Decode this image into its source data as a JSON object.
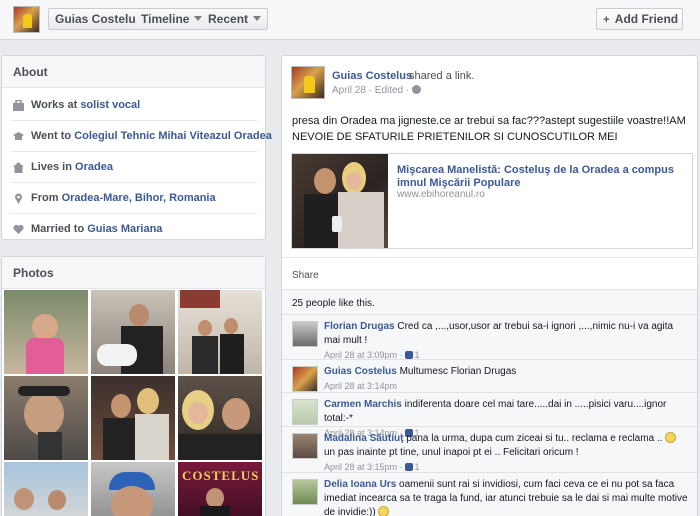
{
  "topbar": {
    "name_label": "Guias Costelus",
    "timeline_label": "Timeline",
    "recent_label": "Recent",
    "add_friend_label": "Add Friend",
    "add_friend_icon": "add-friend-icon"
  },
  "about": {
    "title": "About",
    "rows": [
      {
        "icon": "briefcase-icon",
        "prefix": "Works at ",
        "link": "solist vocal"
      },
      {
        "icon": "graduation-cap-icon",
        "prefix": "Went to ",
        "link": "Colegiul Tehnic Mihai Viteazul Oradea"
      },
      {
        "icon": "house-icon",
        "prefix": "Lives in ",
        "link": "Oradea"
      },
      {
        "icon": "location-pin-icon",
        "prefix": "From ",
        "link": "Oradea-Mare, Bihor, Romania"
      },
      {
        "icon": "heart-icon",
        "prefix": "Married to ",
        "link": "Guias Mariana"
      }
    ]
  },
  "photos": {
    "title": "Photos",
    "top_right_photo_text": "COSTELUS"
  },
  "post": {
    "author": "Guias Costelus",
    "action": "shared a link.",
    "meta": "April 28 · Edited ·",
    "text": "presa din Oradea ma jigneste.ce ar trebui sa fac???astept sugestiile voastre!!AM NEVOIE DE SFATURILE PRIETENILOR SI CUNOSCUTILOR MEI",
    "link_title": "Mişcarea Manelistă: Costeluş de la Oradea a compus imnul Mişcării Populare",
    "link_domain": "www.ebihoreanul.ro",
    "share_label": "Share",
    "likes": "25 people like this."
  },
  "comments": [
    {
      "name": "Florian Drugas",
      "text": "Cred ca ,...,usor,usor ar trebui sa-i ignori ,...,nimic nu-i va agita mai mult !",
      "meta": "April 28 at 3:09pm ·",
      "likes": "1"
    },
    {
      "name": "Guias Costelus",
      "text": "Multumesc Florian Drugas",
      "meta": "April 28 at 3:14pm",
      "likes": ""
    },
    {
      "name": "Carmen Marchis",
      "text": "indiferenta doare cel mai tare.....dai in .....pisici varu....ignor total:-*",
      "meta": "April 28 at 3:14pm ·",
      "likes": "1"
    },
    {
      "name": "Madalina Săutiuţ",
      "text": "pana la urma, dupa cum ziceai si tu.. reclama e reclama ..",
      "text2": " un pas inainte pt tine, unul inapoi pt ei .. Felicitari oricum !",
      "meta": "April 28 at 3:15pm ·",
      "likes": "1"
    },
    {
      "name": "Delia Ioana Urs",
      "text": "oamenii sunt rai si invidiosi, cum faci ceva ce ei nu pot sa faca imediat incearca sa te traga la fund, iar atunci trebuie sa le dai si mai multe motive de invidie:))",
      "meta": "",
      "likes": ""
    }
  ]
}
